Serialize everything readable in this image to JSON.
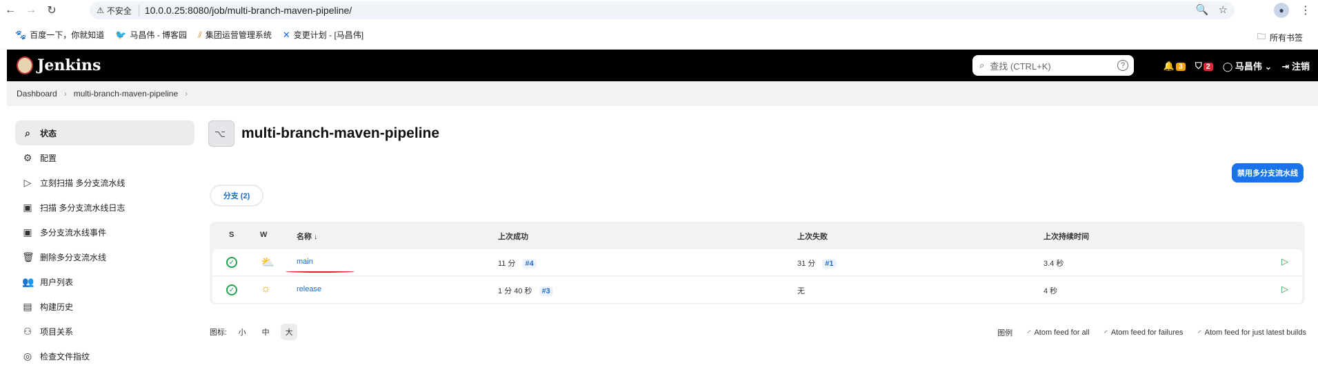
{
  "browser": {
    "insecure_label": "不安全",
    "url": "10.0.0.25:8080/job/multi-branch-maven-pipeline/"
  },
  "bookmarks": {
    "items": [
      {
        "label": "百度一下，你就知道",
        "icon": "baidu-icon"
      },
      {
        "label": "马昌伟 - 博客园",
        "icon": "cnblogs-icon"
      },
      {
        "label": "集团运营管理系统",
        "icon": "system-icon"
      },
      {
        "label": "变更计划 - [马昌伟]",
        "icon": "confluence-icon"
      }
    ],
    "all_label": "所有书签"
  },
  "jenkins": {
    "brand": "Jenkins",
    "search_placeholder": "查找 (CTRL+K)",
    "notifications_count": "3",
    "security_count": "2",
    "user": "马昌伟",
    "logout": "注销"
  },
  "breadcrumb": {
    "items": [
      "Dashboard",
      "multi-branch-maven-pipeline"
    ]
  },
  "sidebar": {
    "items": [
      {
        "label": "状态",
        "icon": "search-icon"
      },
      {
        "label": "配置",
        "icon": "gear-icon"
      },
      {
        "label": "立刻扫描 多分支流水线",
        "icon": "play-icon"
      },
      {
        "label": "扫描 多分支流水线日志",
        "icon": "terminal-icon"
      },
      {
        "label": "多分支流水线事件",
        "icon": "terminal-icon"
      },
      {
        "label": "删除多分支流水线",
        "icon": "trash-icon"
      },
      {
        "label": "用户列表",
        "icon": "users-icon"
      },
      {
        "label": "构建历史",
        "icon": "history-icon"
      },
      {
        "label": "项目关系",
        "icon": "relation-icon"
      },
      {
        "label": "检查文件指纹",
        "icon": "fingerprint-icon"
      }
    ]
  },
  "main": {
    "title": "multi-branch-maven-pipeline",
    "disable_button": "禁用多分支流水线",
    "tab_label": "分支 (2)",
    "table": {
      "headers": {
        "s": "S",
        "w": "W",
        "name": "名称 ↓",
        "last_success": "上次成功",
        "last_failure": "上次失败",
        "last_duration": "上次持续时间"
      },
      "rows": [
        {
          "name": "main",
          "last_success": "11 分",
          "success_run": "#4",
          "last_failure": "31 分",
          "failure_run": "#1",
          "duration": "3.4 秒",
          "weather": "cloud-sun-icon"
        },
        {
          "name": "release",
          "last_success": "1 分 40 秒",
          "success_run": "#3",
          "last_failure": "无",
          "failure_run": "",
          "duration": "4 秒",
          "weather": "sun-icon"
        }
      ]
    },
    "icon_size": {
      "label": "图标:",
      "small": "小",
      "medium": "中",
      "large": "大"
    },
    "legend": "图例",
    "feeds": {
      "all": "Atom feed for all",
      "failures": "Atom feed for failures",
      "latest": "Atom feed for just latest builds"
    }
  },
  "colors": {
    "accent": "#1a73e8",
    "success": "#1ea64a",
    "header": "#000000",
    "badge_orange": "#f1a200",
    "badge_red": "#e0283a"
  }
}
